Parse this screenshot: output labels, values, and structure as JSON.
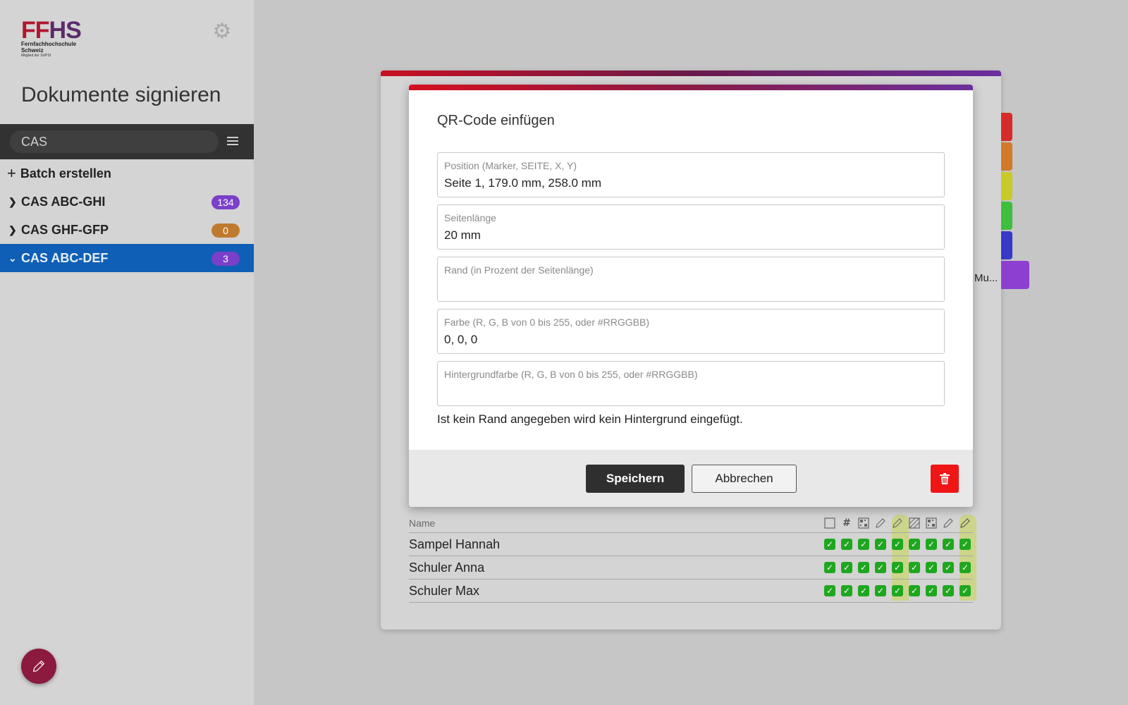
{
  "brand": {
    "logo_main_ff": "FF",
    "logo_main_hs": "HS",
    "logo_line1": "Fernfachhochschule",
    "logo_line2": "Schweiz",
    "logo_sub": "Mitglied der SUPSI",
    "color_red": "#b0172f",
    "color_purple": "#5a2c6a"
  },
  "sidebar": {
    "title": "Dokumente signieren",
    "settings_icon": "gear-icon",
    "search": {
      "value": "CAS",
      "placeholder": ""
    },
    "menu_icon": "hamburger-icon",
    "batch_label": "Batch erstellen",
    "groups": [
      {
        "label": "CAS ABC-GHI",
        "count": "134",
        "badge_color": "#7b3fc9",
        "expanded": false
      },
      {
        "label": "CAS GHF-GFP",
        "count": "0",
        "badge_color": "#c07a2e",
        "expanded": false
      },
      {
        "label": "CAS ABC-DEF",
        "count": "3",
        "badge_color": "#7b3fc9",
        "expanded": true,
        "active": true
      }
    ],
    "fab_icon": "pencil-icon"
  },
  "background_card": {
    "side_tab_colors": [
      "#d62b2b",
      "#d07a2a",
      "#c9c92a",
      "#3fbf3f",
      "#3838c9",
      "#8d3fd0"
    ],
    "truncated_label": "Mu..."
  },
  "modal": {
    "title": "QR-Code einfügen",
    "fields": [
      {
        "label": "Position (Marker, SEITE, X, Y)",
        "value": "Seite 1, 179.0 mm, 258.0 mm"
      },
      {
        "label": "Seitenlänge",
        "value": "20 mm"
      },
      {
        "label": "Rand (in Prozent der Seitenlänge)",
        "value": ""
      },
      {
        "label": "Farbe (R, G, B von 0 bis 255, oder #RRGGBB)",
        "value": "0, 0, 0"
      },
      {
        "label": "Hintergrundfarbe (R, G, B von 0 bis 255, oder #RRGGBB)",
        "value": ""
      }
    ],
    "hint": "Ist kein Rand angegeben wird kein Hintergrund eingefügt.",
    "save_label": "Speichern",
    "cancel_label": "Abbrechen",
    "delete_icon": "trash-icon"
  },
  "table": {
    "name_header": "Name",
    "column_icons": [
      "checkbox-icon",
      "hash-icon",
      "qr-icon",
      "pencil-icon",
      "pencil-icon",
      "hatched-icon",
      "qr-icon",
      "pencil-icon",
      "pencil-icon"
    ],
    "highlighted_columns": [
      4,
      8
    ],
    "rows": [
      {
        "name": "Sampel Hannah",
        "checks": [
          true,
          true,
          true,
          true,
          true,
          true,
          true,
          true,
          true
        ]
      },
      {
        "name": "Schuler Anna",
        "checks": [
          true,
          true,
          true,
          true,
          true,
          true,
          true,
          true,
          true
        ]
      },
      {
        "name": "Schuler Max",
        "checks": [
          true,
          true,
          true,
          true,
          true,
          true,
          true,
          true,
          true
        ]
      }
    ],
    "check_color": "#1fa71f",
    "highlight_color": "#cdd58a"
  }
}
